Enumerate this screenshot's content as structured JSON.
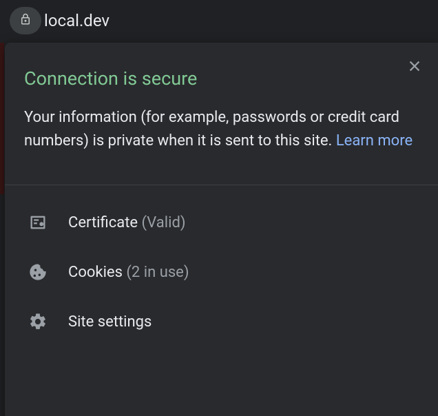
{
  "address_bar": {
    "url": "local.dev"
  },
  "popup": {
    "title": "Connection is secure",
    "description_before": "Your information (for example, passwords or credit card numbers) is private when it is sent to this site. ",
    "learn_more": "Learn more",
    "menu": {
      "certificate": {
        "label": "Certificate ",
        "status": "(Valid)"
      },
      "cookies": {
        "label": "Cookies ",
        "status": "(2 in use)"
      },
      "site_settings": {
        "label": "Site settings"
      }
    }
  }
}
